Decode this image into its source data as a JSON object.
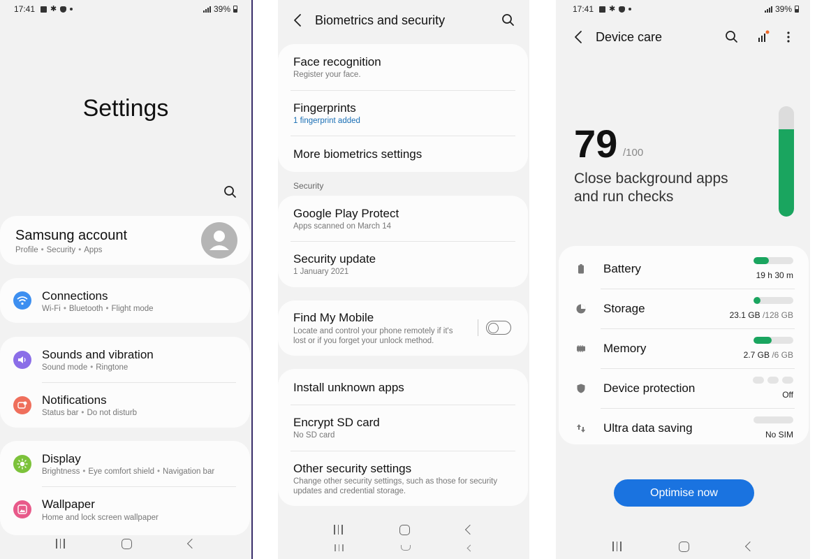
{
  "status_bar": {
    "time": "17:41",
    "battery": "39%"
  },
  "settings": {
    "title": "Settings",
    "account": {
      "title": "Samsung account",
      "subtitle": [
        "Profile",
        "Security",
        "Apps"
      ]
    },
    "items": [
      {
        "title": "Connections",
        "subtitle": [
          "Wi-Fi",
          "Bluetooth",
          "Flight mode"
        ],
        "color": "#3d8ff0"
      },
      {
        "title": "Sounds and vibration",
        "subtitle": [
          "Sound mode",
          "Ringtone"
        ],
        "color": "#8b6ee8"
      },
      {
        "title": "Notifications",
        "subtitle": [
          "Status bar",
          "Do not disturb"
        ],
        "color": "#ef6f5c"
      },
      {
        "title": "Display",
        "subtitle": [
          "Brightness",
          "Eye comfort shield",
          "Navigation bar"
        ],
        "color": "#7cc23a"
      },
      {
        "title": "Wallpaper",
        "subtitle": [
          "Home and lock screen wallpaper"
        ],
        "color": "#e85a8a"
      }
    ]
  },
  "biometrics": {
    "title": "Biometrics and security",
    "face": {
      "title": "Face recognition",
      "subtitle": "Register your face."
    },
    "fingerprints": {
      "title": "Fingerprints",
      "subtitle": "1 fingerprint added"
    },
    "more": {
      "title": "More biometrics settings"
    },
    "section_label": "Security",
    "play_protect": {
      "title": "Google Play Protect",
      "subtitle": "Apps scanned on March 14"
    },
    "security_update": {
      "title": "Security update",
      "subtitle": "1 January 2021"
    },
    "find_my_mobile": {
      "title": "Find My Mobile",
      "subtitle_1": "Locate and control your phone remotely if it's",
      "subtitle_2": "lost or if you forget your unlock method.",
      "enabled": false
    },
    "install_unknown": {
      "title": "Install unknown apps"
    },
    "encrypt_sd": {
      "title": "Encrypt SD card",
      "subtitle": "No SD card"
    },
    "other_security": {
      "title": "Other security settings",
      "subtitle_1": "Change other security settings, such as those for security",
      "subtitle_2": "updates and credential storage."
    }
  },
  "device_care": {
    "title": "Device care",
    "score": "79",
    "score_max": "/100",
    "score_fraction": 0.79,
    "message_1": "Close background apps",
    "message_2": "and run checks",
    "accent": "#1aa55f",
    "items": [
      {
        "label": "Battery",
        "value": "19 h 30 m",
        "unit": "",
        "fill": 0.38,
        "icon": "battery-icon"
      },
      {
        "label": "Storage",
        "value": "23.1 GB",
        "unit": " /128 GB",
        "fill": 0.18,
        "icon": "storage-icon"
      },
      {
        "label": "Memory",
        "value": "2.7 GB",
        "unit": " /6 GB",
        "fill": 0.45,
        "icon": "memory-icon"
      },
      {
        "label": "Device protection",
        "value": "Off",
        "unit": "",
        "fill": 0,
        "icon": "shield-icon"
      },
      {
        "label": "Ultra data saving",
        "value": "No SIM",
        "unit": "",
        "fill": 0,
        "icon": "data-saving-icon"
      }
    ],
    "optimise_label": "Optimise now",
    "button_color": "#1a73e0"
  }
}
